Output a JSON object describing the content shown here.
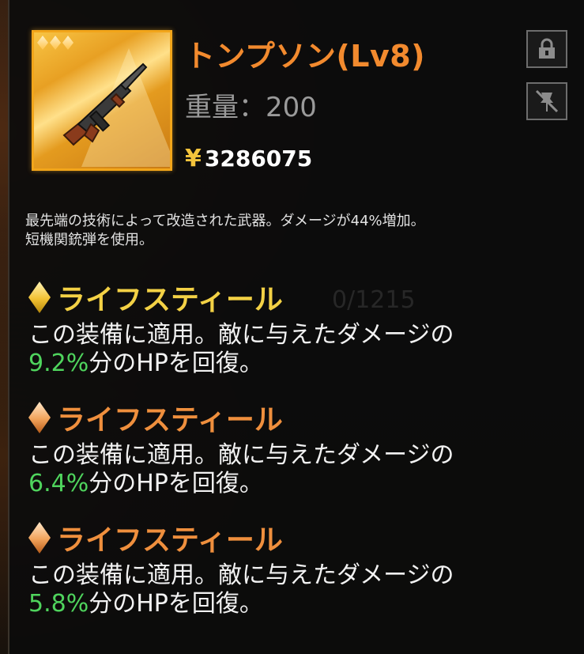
{
  "item": {
    "name": "トンプソン(Lv8)",
    "weight_label": "重量：200",
    "currency_symbol": "¥",
    "price": "3286075",
    "rarity_stars": 3,
    "description_line1": "最先端の技術によって改造された武器。ダメージが44%増加。",
    "description_line2": "短機関銃弾を使用。"
  },
  "buttons": {
    "lock_icon": "lock-icon",
    "pin_icon": "unpin-icon"
  },
  "background_text": "0/1215",
  "effects": [
    {
      "name": "ライフスティール",
      "gem_color": "gold",
      "text_before": "この装備に適用。敵に与えたダメージの",
      "percent": "9.2%",
      "text_after": "分のHPを回復。"
    },
    {
      "name": "ライフスティール",
      "gem_color": "orange",
      "text_before": "この装備に適用。敵に与えたダメージの",
      "percent": "6.4%",
      "text_after": "分のHPを回復。"
    },
    {
      "name": "ライフスティール",
      "gem_color": "orange",
      "text_before": "この装備に適用。敵に与えたダメージの",
      "percent": "5.8%",
      "text_after": "分のHPを回復。"
    }
  ],
  "colors": {
    "title": "#f28a2e",
    "gold_effect": "#f3d145",
    "orange_effect": "#ef8f3d",
    "percent_green": "#4fd45d",
    "frame_gold": "#f2a51a"
  }
}
